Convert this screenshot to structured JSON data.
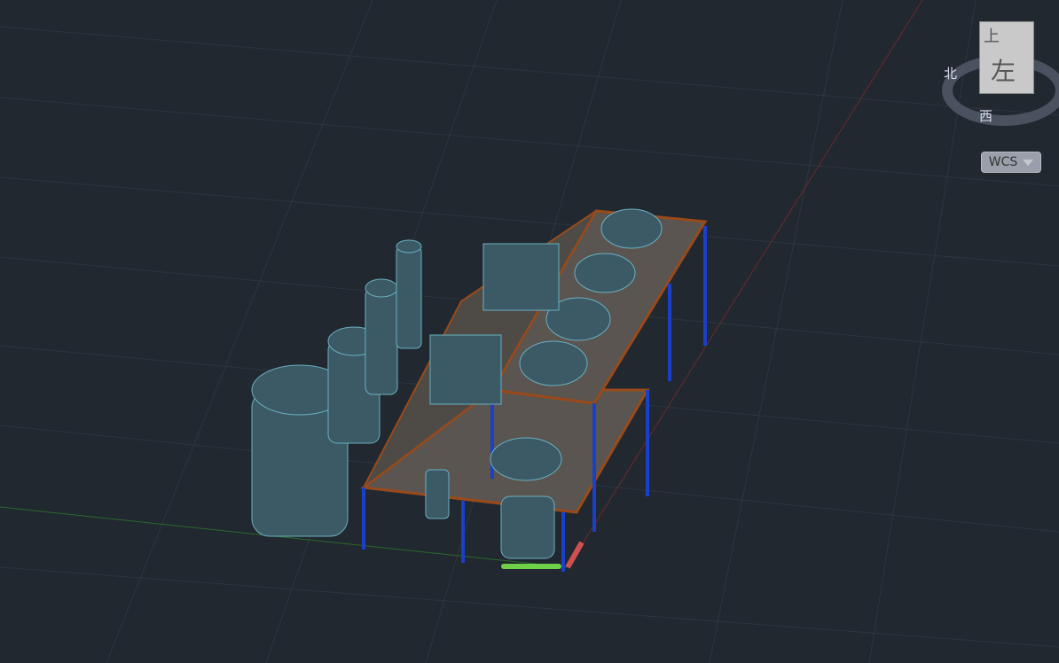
{
  "viewcube": {
    "top_label": "上",
    "front_label": "左",
    "ring_north": "北",
    "ring_west": "西"
  },
  "ucs_menu": {
    "label": "WCS",
    "icon": "chevron-down-icon"
  },
  "colors": {
    "background": "#212830",
    "grid": "#2c343e",
    "steel": "#1a3fc8",
    "platform": "#9a4a1a",
    "tanks": "#3b5a66",
    "annotation": "#ff4a1a",
    "x_axis": "#b03030",
    "y_axis": "#2f8a2f"
  }
}
